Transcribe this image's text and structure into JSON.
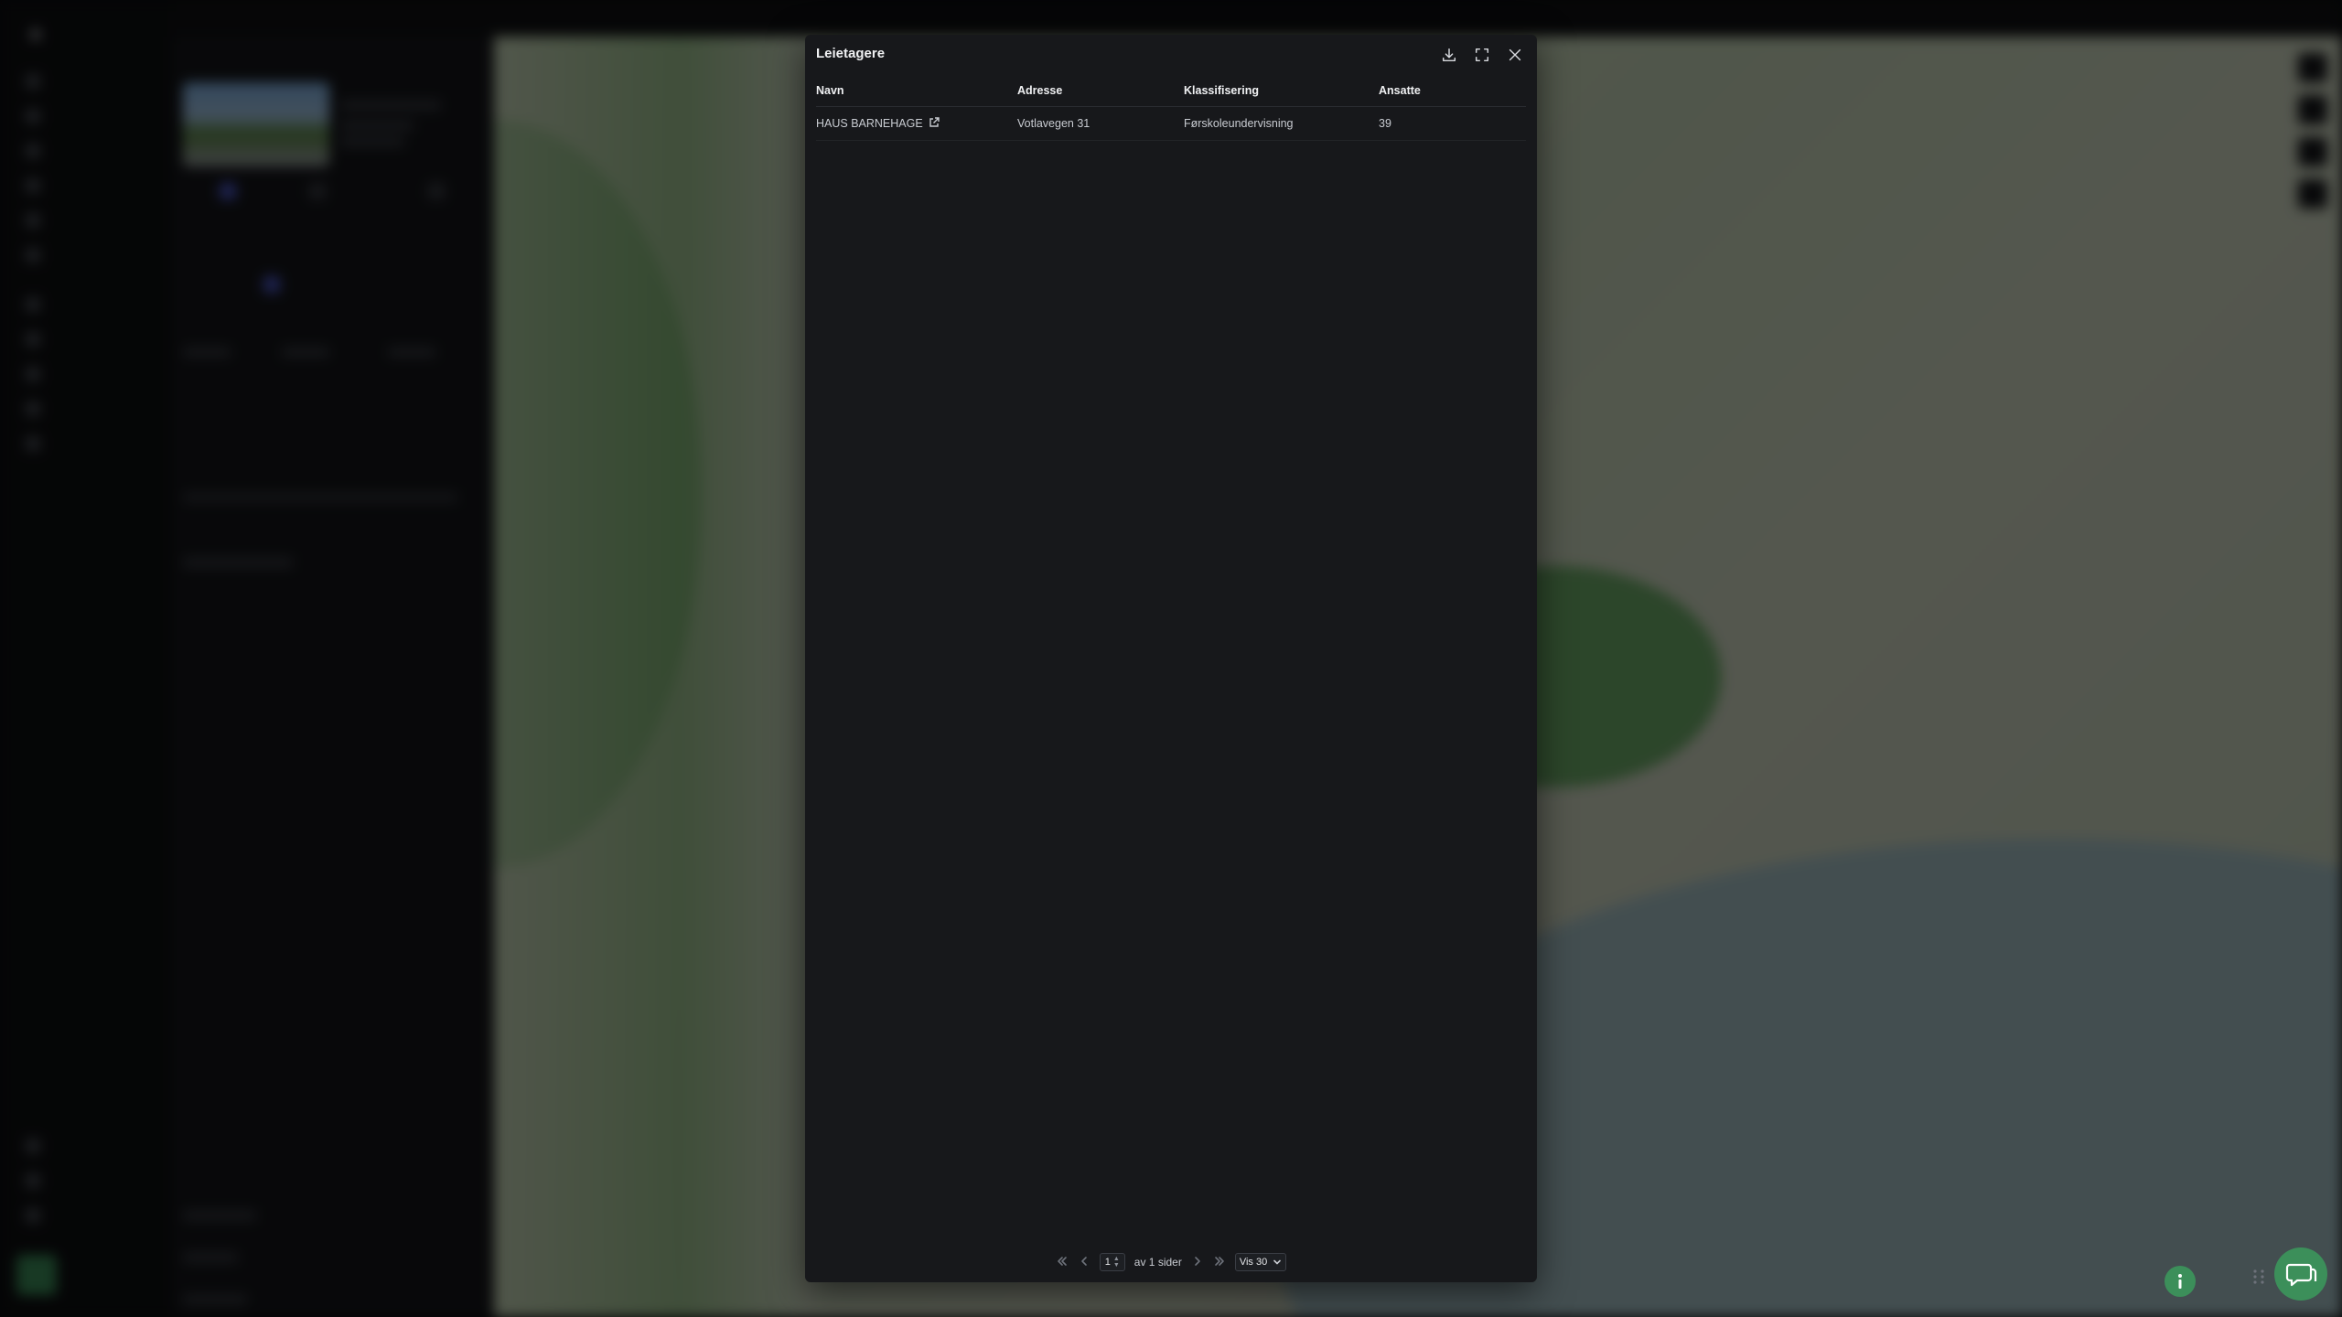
{
  "modal": {
    "title": "Leietagere",
    "columns": [
      "Navn",
      "Adresse",
      "Klassifisering",
      "Ansatte"
    ],
    "rows": [
      {
        "navn": "HAUS BARNEHAGE",
        "adresse": "Votlavegen 31",
        "klassifisering": "Førskoleundervisning",
        "ansatte": "39"
      }
    ],
    "pagination": {
      "current_page": "1",
      "of_pages_label": "av 1 sider",
      "page_size_label": "Vis 30"
    }
  },
  "colors": {
    "modal_bg": "#17181b",
    "accent_green": "#3c8f5a",
    "badge_pink": "#c2186b"
  }
}
